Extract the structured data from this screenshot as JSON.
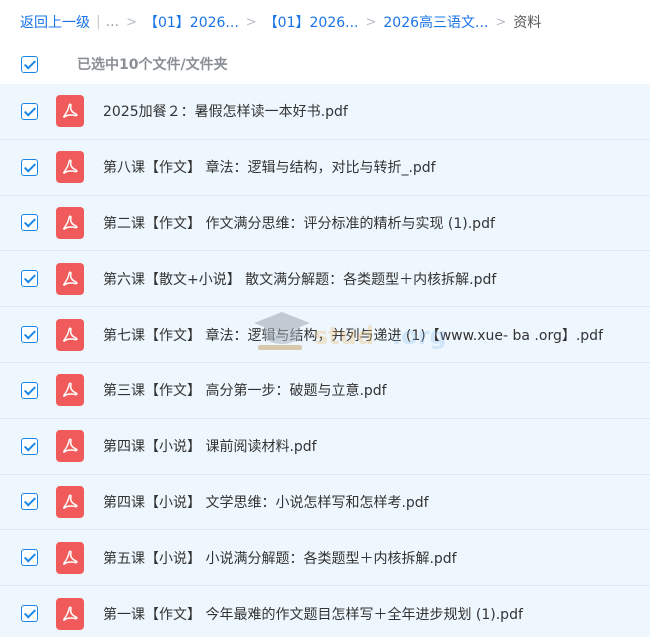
{
  "breadcrumb": {
    "back": "返回上一级",
    "ellipsis": "...",
    "crumbs": [
      "【01】2026...",
      "【01】2026...",
      "2026高三语文..."
    ],
    "current": "资料"
  },
  "selection": {
    "label": "已选中10个文件/文件夹"
  },
  "files": [
    {
      "name": "2025加餐２：暑假怎样读一本好书.pdf"
    },
    {
      "name": "第八课【作文】 章法：逻辑与结构，对比与转折_.pdf"
    },
    {
      "name": "第二课【作文】 作文满分思维：评分标准的精析与实现 (1).pdf"
    },
    {
      "name": "第六课【散文+小说】 散文满分解题：各类题型＋内核拆解.pdf"
    },
    {
      "name": "第七课【作文】 章法：逻辑与结构，并列与递进 (1)【www.xue- ba .org】.pdf"
    },
    {
      "name": "第三课【作文】 高分第一步：破题与立意.pdf"
    },
    {
      "name": "第四课【小说】 课前阅读材料.pdf"
    },
    {
      "name": "第四课【小说】 文学思维：小说怎样写和怎样考.pdf"
    },
    {
      "name": "第五课【小说】 小说满分解题：各类题型＋内核拆解.pdf"
    },
    {
      "name": "第一课【作文】 今年最难的作文题目怎样写＋全年进步规划 (1).pdf"
    }
  ],
  "icons": {
    "file": "pdf-icon",
    "check": "checkbox-checked-icon"
  },
  "colors": {
    "accent": "#1a74e8",
    "pdf": "#f15a5a",
    "row_bg": "#eef7fe"
  }
}
